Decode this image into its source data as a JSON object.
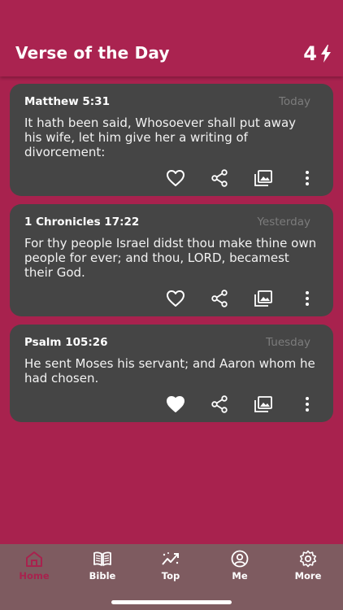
{
  "header": {
    "title": "Verse of the Day",
    "streak_count": "4",
    "streak_icon": "lightning-icon"
  },
  "verses": [
    {
      "reference": "Matthew 5:31",
      "date": "Today",
      "text": "It hath been said, Whosoever shall put away his wife, let him give her a writing of divorcement:",
      "liked": false
    },
    {
      "reference": "1 Chronicles 17:22",
      "date": "Yesterday",
      "text": "For thy people Israel didst thou make thine own people for ever; and thou, LORD, becamest their God.",
      "liked": false
    },
    {
      "reference": "Psalm 105:26",
      "date": "Tuesday",
      "text": "He sent Moses his servant; and Aaron whom he had chosen.",
      "liked": true
    }
  ],
  "tabs": [
    {
      "label": "Home",
      "icon": "home-icon",
      "active": true
    },
    {
      "label": "Bible",
      "icon": "book-icon",
      "active": false
    },
    {
      "label": "Top",
      "icon": "trending-icon",
      "active": false
    },
    {
      "label": "Me",
      "icon": "profile-icon",
      "active": false
    },
    {
      "label": "More",
      "icon": "gear-icon",
      "active": false
    }
  ],
  "colors": {
    "background": "#a8224e",
    "card": "#454545",
    "tabbar": "#7e5b60",
    "muted_date": "#7c7c7c"
  }
}
